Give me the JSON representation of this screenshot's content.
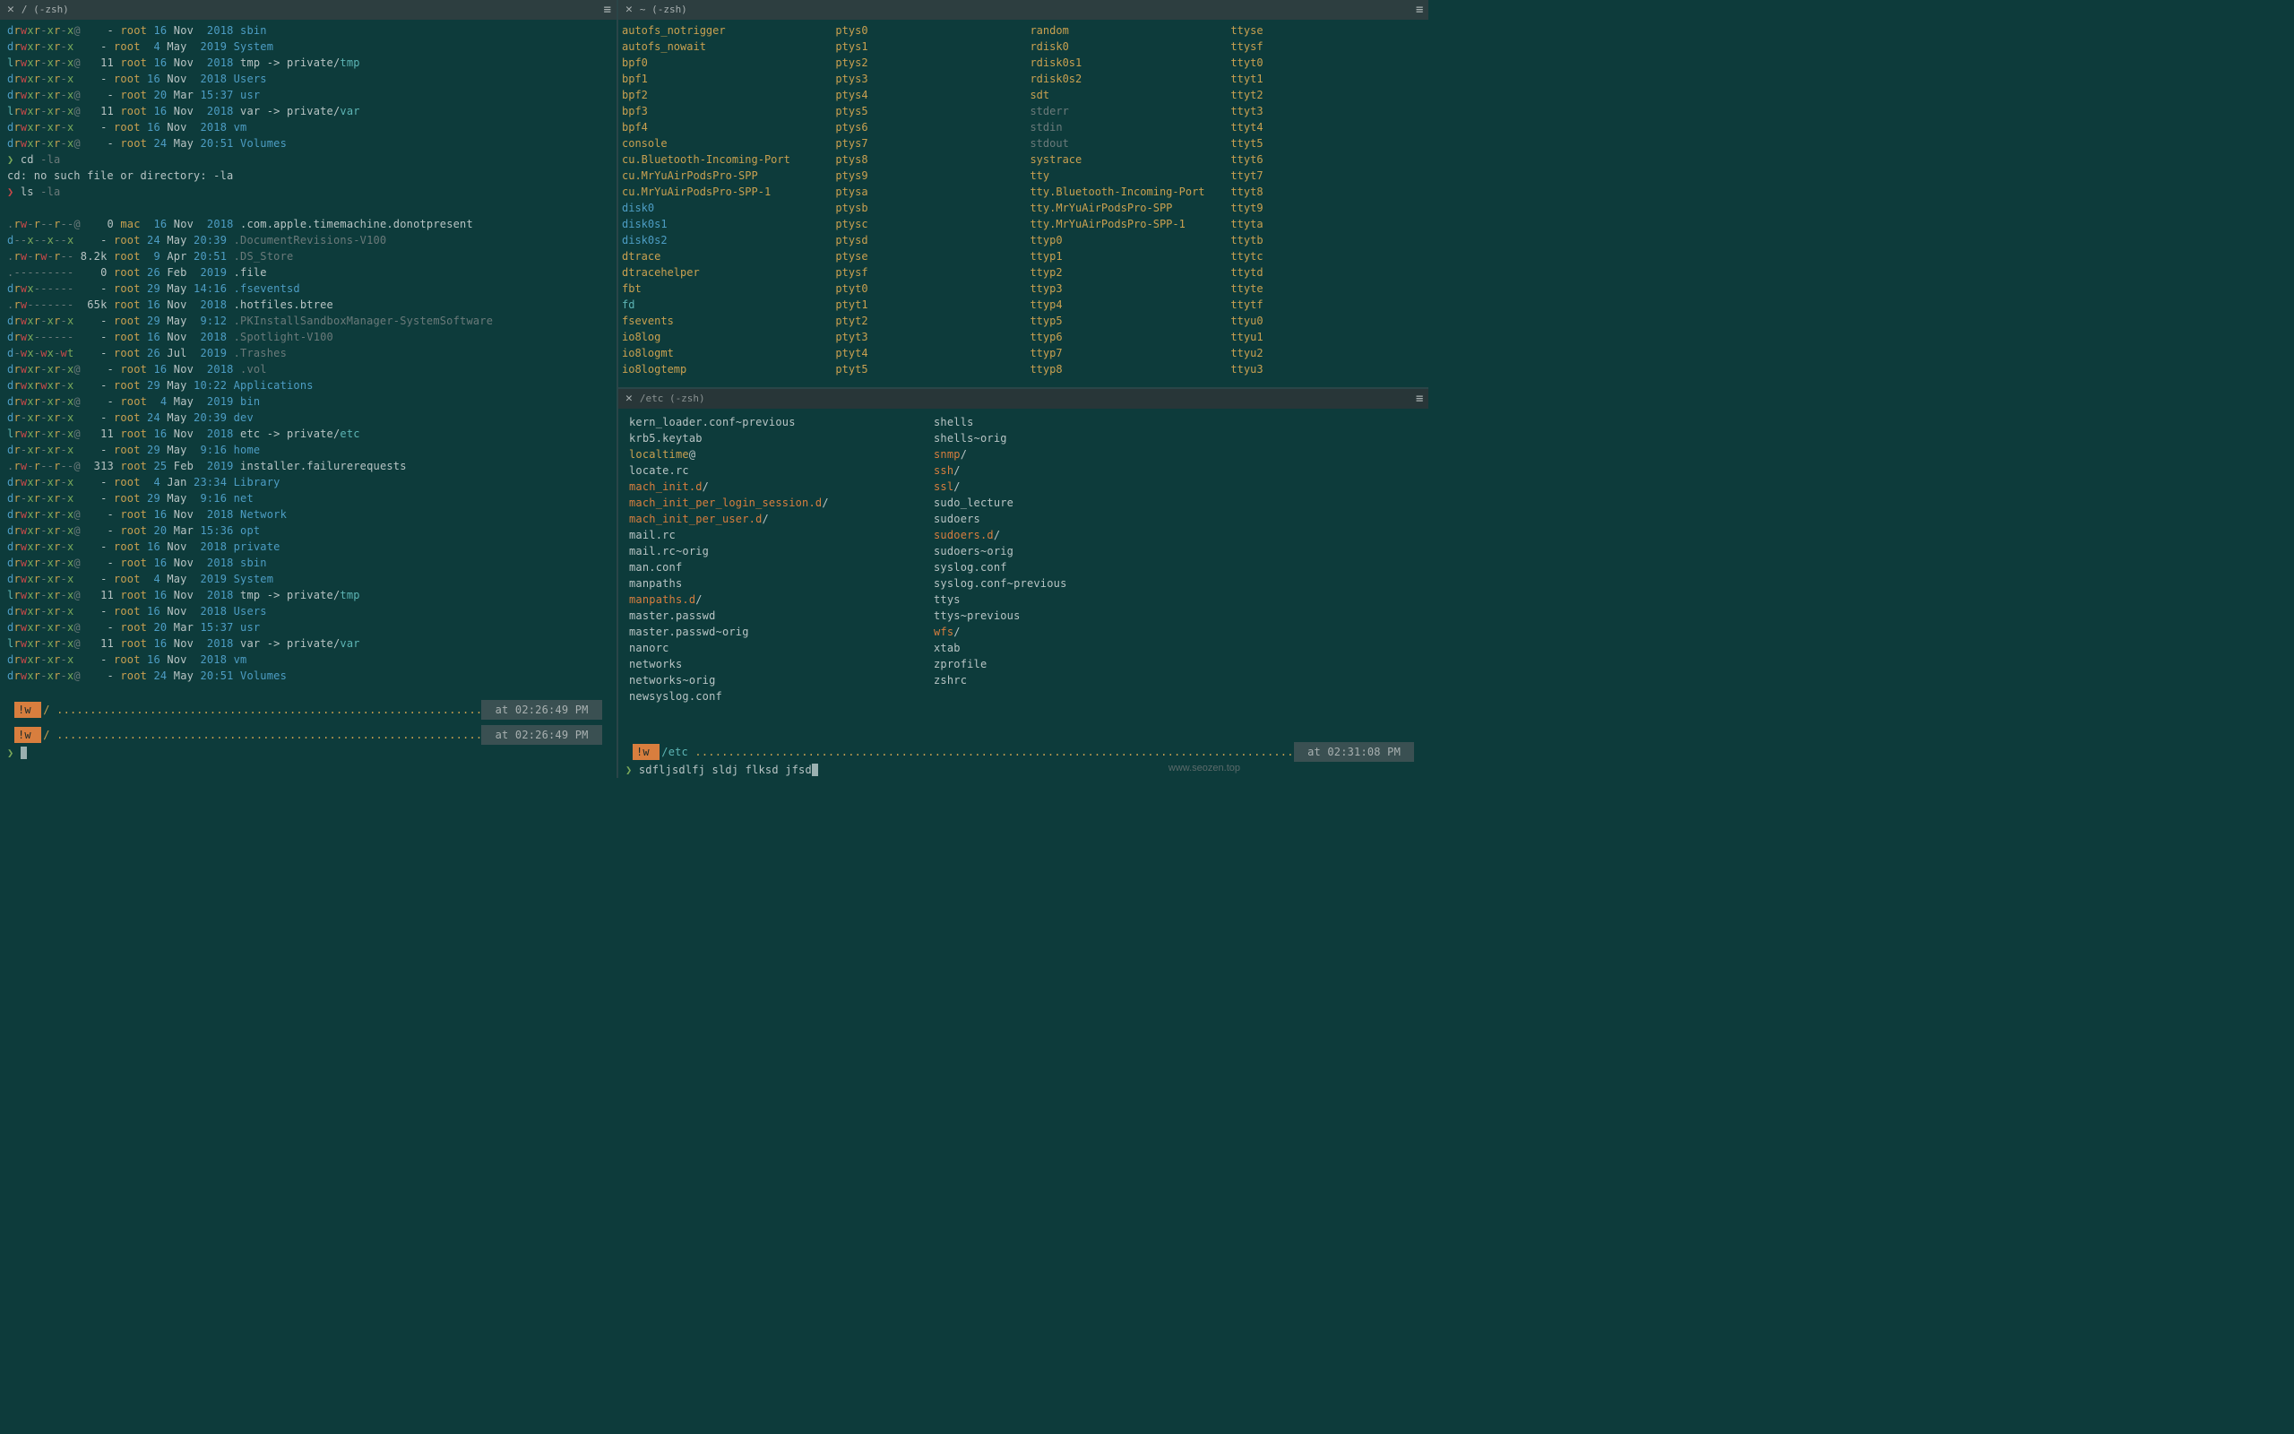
{
  "watermark": "www.seozen.top",
  "panes": {
    "left": {
      "tab_title": "/ (-zsh)",
      "status_path": "/",
      "status_time": "02:26:49 PM",
      "prompt": "❯"
    },
    "right_top": {
      "tab_title": "~ (-zsh)"
    },
    "right_bot": {
      "tab_title": "/etc (-zsh)",
      "status_path": "/etc",
      "status_time": "02:31:08 PM",
      "prompt": "❯",
      "typed": "sdfljsdlfj sldj flksd jfsd"
    }
  },
  "left_lines": [
    {
      "perm": "drwxr-xr-x@",
      "links": "-",
      "owner": "root",
      "d": "16",
      "mon": "Nov",
      "y": "2018",
      "name": "sbin",
      "cls": "c-blue"
    },
    {
      "perm": "drwxr-xr-x",
      "links": "-",
      "owner": "root",
      "d": "4",
      "mon": "May",
      "y": "2019",
      "name": "System",
      "cls": "c-blue"
    },
    {
      "perm": "lrwxr-xr-x@",
      "links": "11",
      "owner": "root",
      "d": "16",
      "mon": "Nov",
      "y": "2018",
      "name": "tmp -> private/",
      "tail": "tmp",
      "cls": "",
      "tcls": "c-cyan"
    },
    {
      "perm": "drwxr-xr-x",
      "links": "-",
      "owner": "root",
      "d": "16",
      "mon": "Nov",
      "y": "2018",
      "name": "Users",
      "cls": "c-blue"
    },
    {
      "perm": "drwxr-xr-x@",
      "links": "-",
      "owner": "root",
      "d": "20",
      "mon": "Mar",
      "y": "15:37",
      "name": "usr",
      "cls": "c-blue"
    },
    {
      "perm": "lrwxr-xr-x@",
      "links": "11",
      "owner": "root",
      "d": "16",
      "mon": "Nov",
      "y": "2018",
      "name": "var -> private/",
      "tail": "var",
      "cls": "",
      "tcls": "c-cyan"
    },
    {
      "perm": "drwxr-xr-x",
      "links": "-",
      "owner": "root",
      "d": "16",
      "mon": "Nov",
      "y": "2018",
      "name": "vm",
      "cls": "c-blue"
    },
    {
      "perm": "drwxr-xr-x@",
      "links": "-",
      "owner": "root",
      "d": "24",
      "mon": "May",
      "y": "20:51",
      "name": "Volumes",
      "cls": "c-blue"
    }
  ],
  "left_cmds": [
    {
      "prompt": "❯",
      "cmd": "cd -la",
      "err": "cd: no such file or directory: -la"
    },
    {
      "prompt": "❯",
      "cmd": "ls -la"
    }
  ],
  "left_ls2": [
    {
      "perm": ".rw-r--r--@",
      "links": "0",
      "owner": "mac",
      "d": "16",
      "mon": "Nov",
      "y": "2018",
      "name": ".com.apple.timemachine.donotpresent",
      "cls": ""
    },
    {
      "perm": "d--x--x--x",
      "links": "-",
      "owner": "root",
      "d": "24",
      "mon": "May",
      "y": "20:39",
      "name": ".DocumentRevisions-V100",
      "cls": "c-grey"
    },
    {
      "perm": ".rw-rw-r--",
      "links": "8.2k",
      "owner": "root",
      "d": "9",
      "mon": "Apr",
      "y": "20:51",
      "name": ".DS_Store",
      "cls": "c-grey"
    },
    {
      "perm": ".---------",
      "links": "0",
      "owner": "root",
      "d": "26",
      "mon": "Feb",
      "y": "2019",
      "name": ".file",
      "cls": ""
    },
    {
      "perm": "drwx------",
      "links": "-",
      "owner": "root",
      "d": "29",
      "mon": "May",
      "y": "14:16",
      "name": ".fseventsd",
      "cls": "c-blue"
    },
    {
      "perm": ".rw-------",
      "links": "65k",
      "owner": "root",
      "d": "16",
      "mon": "Nov",
      "y": "2018",
      "name": ".hotfiles.btree",
      "cls": ""
    },
    {
      "perm": "drwxr-xr-x",
      "links": "-",
      "owner": "root",
      "d": "29",
      "mon": "May",
      "y": "9:12",
      "name": ".PKInstallSandboxManager-SystemSoftware",
      "cls": "c-grey"
    },
    {
      "perm": "drwx------",
      "links": "-",
      "owner": "root",
      "d": "16",
      "mon": "Nov",
      "y": "2018",
      "name": ".Spotlight-V100",
      "cls": "c-grey"
    },
    {
      "perm": "d-wx-wx-wt",
      "links": "-",
      "owner": "root",
      "d": "26",
      "mon": "Jul",
      "y": "2019",
      "name": ".Trashes",
      "cls": "c-grey"
    },
    {
      "perm": "drwxr-xr-x@",
      "links": "-",
      "owner": "root",
      "d": "16",
      "mon": "Nov",
      "y": "2018",
      "name": ".vol",
      "cls": "c-grey"
    },
    {
      "perm": "drwxrwxr-x",
      "links": "-",
      "owner": "root",
      "d": "29",
      "mon": "May",
      "y": "10:22",
      "name": "Applications",
      "cls": "c-blue"
    },
    {
      "perm": "drwxr-xr-x@",
      "links": "-",
      "owner": "root",
      "d": "4",
      "mon": "May",
      "y": "2019",
      "name": "bin",
      "cls": "c-blue"
    },
    {
      "perm": "dr-xr-xr-x",
      "links": "-",
      "owner": "root",
      "d": "24",
      "mon": "May",
      "y": "20:39",
      "name": "dev",
      "cls": "c-blue"
    },
    {
      "perm": "lrwxr-xr-x@",
      "links": "11",
      "owner": "root",
      "d": "16",
      "mon": "Nov",
      "y": "2018",
      "name": "etc -> private/",
      "tail": "etc",
      "cls": "",
      "tcls": "c-cyan"
    },
    {
      "perm": "dr-xr-xr-x",
      "links": "-",
      "owner": "root",
      "d": "29",
      "mon": "May",
      "y": "9:16",
      "name": "home",
      "cls": "c-blue"
    },
    {
      "perm": ".rw-r--r--@",
      "links": "313",
      "owner": "root",
      "d": "25",
      "mon": "Feb",
      "y": "2019",
      "name": "installer.failurerequests",
      "cls": ""
    },
    {
      "perm": "drwxr-xr-x",
      "links": "-",
      "owner": "root",
      "d": "4",
      "mon": "Jan",
      "y": "23:34",
      "name": "Library",
      "cls": "c-blue"
    },
    {
      "perm": "dr-xr-xr-x",
      "links": "-",
      "owner": "root",
      "d": "29",
      "mon": "May",
      "y": "9:16",
      "name": "net",
      "cls": "c-blue"
    },
    {
      "perm": "drwxr-xr-x@",
      "links": "-",
      "owner": "root",
      "d": "16",
      "mon": "Nov",
      "y": "2018",
      "name": "Network",
      "cls": "c-blue"
    },
    {
      "perm": "drwxr-xr-x@",
      "links": "-",
      "owner": "root",
      "d": "20",
      "mon": "Mar",
      "y": "15:36",
      "name": "opt",
      "cls": "c-blue"
    },
    {
      "perm": "drwxr-xr-x",
      "links": "-",
      "owner": "root",
      "d": "16",
      "mon": "Nov",
      "y": "2018",
      "name": "private",
      "cls": "c-blue"
    },
    {
      "perm": "drwxr-xr-x@",
      "links": "-",
      "owner": "root",
      "d": "16",
      "mon": "Nov",
      "y": "2018",
      "name": "sbin",
      "cls": "c-blue"
    },
    {
      "perm": "drwxr-xr-x",
      "links": "-",
      "owner": "root",
      "d": "4",
      "mon": "May",
      "y": "2019",
      "name": "System",
      "cls": "c-blue"
    },
    {
      "perm": "lrwxr-xr-x@",
      "links": "11",
      "owner": "root",
      "d": "16",
      "mon": "Nov",
      "y": "2018",
      "name": "tmp -> private/",
      "tail": "tmp",
      "cls": "",
      "tcls": "c-cyan"
    },
    {
      "perm": "drwxr-xr-x",
      "links": "-",
      "owner": "root",
      "d": "16",
      "mon": "Nov",
      "y": "2018",
      "name": "Users",
      "cls": "c-blue"
    },
    {
      "perm": "drwxr-xr-x@",
      "links": "-",
      "owner": "root",
      "d": "20",
      "mon": "Mar",
      "y": "15:37",
      "name": "usr",
      "cls": "c-blue"
    },
    {
      "perm": "lrwxr-xr-x@",
      "links": "11",
      "owner": "root",
      "d": "16",
      "mon": "Nov",
      "y": "2018",
      "name": "var -> private/",
      "tail": "var",
      "cls": "",
      "tcls": "c-cyan"
    },
    {
      "perm": "drwxr-xr-x",
      "links": "-",
      "owner": "root",
      "d": "16",
      "mon": "Nov",
      "y": "2018",
      "name": "vm",
      "cls": "c-blue"
    },
    {
      "perm": "drwxr-xr-x@",
      "links": "-",
      "owner": "root",
      "d": "24",
      "mon": "May",
      "y": "20:51",
      "name": "Volumes",
      "cls": "c-blue"
    }
  ],
  "dev_cols": [
    [
      {
        "t": "autofs_notrigger",
        "c": "c-yellow"
      },
      {
        "t": "autofs_nowait",
        "c": "c-yellow"
      },
      {
        "t": "bpf0",
        "c": "c-yellow"
      },
      {
        "t": "bpf1",
        "c": "c-yellow"
      },
      {
        "t": "bpf2",
        "c": "c-yellow"
      },
      {
        "t": "bpf3",
        "c": "c-yellow"
      },
      {
        "t": "bpf4",
        "c": "c-yellow"
      },
      {
        "t": "console",
        "c": "c-yellow"
      },
      {
        "t": "cu.Bluetooth-Incoming-Port",
        "c": "c-yellow"
      },
      {
        "t": "cu.MrYuAirPodsPro-SPP",
        "c": "c-yellow"
      },
      {
        "t": "cu.MrYuAirPodsPro-SPP-1",
        "c": "c-yellow"
      },
      {
        "t": "disk0",
        "c": "c-blue"
      },
      {
        "t": "disk0s1",
        "c": "c-blue"
      },
      {
        "t": "disk0s2",
        "c": "c-blue"
      },
      {
        "t": "dtrace",
        "c": "c-yellow"
      },
      {
        "t": "dtracehelper",
        "c": "c-yellow"
      },
      {
        "t": "fbt",
        "c": "c-yellow"
      },
      {
        "t": "fd",
        "c": "c-cyan"
      },
      {
        "t": "fsevents",
        "c": "c-yellow"
      },
      {
        "t": "io8log",
        "c": "c-yellow"
      },
      {
        "t": "io8logmt",
        "c": "c-yellow"
      },
      {
        "t": "io8logtemp",
        "c": "c-yellow"
      }
    ],
    [
      {
        "t": "ptys0",
        "c": "c-yellow"
      },
      {
        "t": "ptys1",
        "c": "c-yellow"
      },
      {
        "t": "ptys2",
        "c": "c-yellow"
      },
      {
        "t": "ptys3",
        "c": "c-yellow"
      },
      {
        "t": "ptys4",
        "c": "c-yellow"
      },
      {
        "t": "ptys5",
        "c": "c-yellow"
      },
      {
        "t": "ptys6",
        "c": "c-yellow"
      },
      {
        "t": "ptys7",
        "c": "c-yellow"
      },
      {
        "t": "ptys8",
        "c": "c-yellow"
      },
      {
        "t": "ptys9",
        "c": "c-yellow"
      },
      {
        "t": "ptysa",
        "c": "c-yellow"
      },
      {
        "t": "ptysb",
        "c": "c-yellow"
      },
      {
        "t": "ptysc",
        "c": "c-yellow"
      },
      {
        "t": "ptysd",
        "c": "c-yellow"
      },
      {
        "t": "ptyse",
        "c": "c-yellow"
      },
      {
        "t": "ptysf",
        "c": "c-yellow"
      },
      {
        "t": "ptyt0",
        "c": "c-yellow"
      },
      {
        "t": "ptyt1",
        "c": "c-yellow"
      },
      {
        "t": "ptyt2",
        "c": "c-yellow"
      },
      {
        "t": "ptyt3",
        "c": "c-yellow"
      },
      {
        "t": "ptyt4",
        "c": "c-yellow"
      },
      {
        "t": "ptyt5",
        "c": "c-yellow"
      }
    ],
    [
      {
        "t": "random",
        "c": "c-yellow"
      },
      {
        "t": "rdisk0",
        "c": "c-yellow"
      },
      {
        "t": "rdisk0s1",
        "c": "c-yellow"
      },
      {
        "t": "rdisk0s2",
        "c": "c-yellow"
      },
      {
        "t": "sdt",
        "c": "c-yellow"
      },
      {
        "t": "stderr",
        "c": "c-grey"
      },
      {
        "t": "stdin",
        "c": "c-grey"
      },
      {
        "t": "stdout",
        "c": "c-grey"
      },
      {
        "t": "systrace",
        "c": "c-yellow"
      },
      {
        "t": "tty",
        "c": "c-yellow"
      },
      {
        "t": "tty.Bluetooth-Incoming-Port",
        "c": "c-yellow"
      },
      {
        "t": "tty.MrYuAirPodsPro-SPP",
        "c": "c-yellow"
      },
      {
        "t": "tty.MrYuAirPodsPro-SPP-1",
        "c": "c-yellow"
      },
      {
        "t": "ttyp0",
        "c": "c-yellow"
      },
      {
        "t": "ttyp1",
        "c": "c-yellow"
      },
      {
        "t": "ttyp2",
        "c": "c-yellow"
      },
      {
        "t": "ttyp3",
        "c": "c-yellow"
      },
      {
        "t": "ttyp4",
        "c": "c-yellow"
      },
      {
        "t": "ttyp5",
        "c": "c-yellow"
      },
      {
        "t": "ttyp6",
        "c": "c-yellow"
      },
      {
        "t": "ttyp7",
        "c": "c-yellow"
      },
      {
        "t": "ttyp8",
        "c": "c-yellow"
      }
    ],
    [
      {
        "t": "ttyse",
        "c": "c-yellow"
      },
      {
        "t": "ttysf",
        "c": "c-yellow"
      },
      {
        "t": "ttyt0",
        "c": "c-yellow"
      },
      {
        "t": "ttyt1",
        "c": "c-yellow"
      },
      {
        "t": "ttyt2",
        "c": "c-yellow"
      },
      {
        "t": "ttyt3",
        "c": "c-yellow"
      },
      {
        "t": "ttyt4",
        "c": "c-yellow"
      },
      {
        "t": "ttyt5",
        "c": "c-yellow"
      },
      {
        "t": "ttyt6",
        "c": "c-yellow"
      },
      {
        "t": "ttyt7",
        "c": "c-yellow"
      },
      {
        "t": "ttyt8",
        "c": "c-yellow"
      },
      {
        "t": "ttyt9",
        "c": "c-yellow"
      },
      {
        "t": "ttyta",
        "c": "c-yellow"
      },
      {
        "t": "ttytb",
        "c": "c-yellow"
      },
      {
        "t": "ttytc",
        "c": "c-yellow"
      },
      {
        "t": "ttytd",
        "c": "c-yellow"
      },
      {
        "t": "ttyte",
        "c": "c-yellow"
      },
      {
        "t": "ttytf",
        "c": "c-yellow"
      },
      {
        "t": "ttyu0",
        "c": "c-yellow"
      },
      {
        "t": "ttyu1",
        "c": "c-yellow"
      },
      {
        "t": "ttyu2",
        "c": "c-yellow"
      },
      {
        "t": "ttyu3",
        "c": "c-yellow"
      }
    ]
  ],
  "etc_cols": [
    [
      {
        "t": "kern_loader.conf\\~previous",
        "c": ""
      },
      {
        "t": "krb5.keytab",
        "c": ""
      },
      {
        "t": "localtime",
        "c": "c-yellow",
        "suf": "@"
      },
      {
        "t": "locate.rc",
        "c": ""
      },
      {
        "t": "mach_init.d",
        "c": "c-orange",
        "suf": "/"
      },
      {
        "t": "mach_init_per_login_session.d",
        "c": "c-orange",
        "suf": "/"
      },
      {
        "t": "mach_init_per_user.d",
        "c": "c-orange",
        "suf": "/"
      },
      {
        "t": "mail.rc",
        "c": ""
      },
      {
        "t": "mail.rc\\~orig",
        "c": ""
      },
      {
        "t": "man.conf",
        "c": ""
      },
      {
        "t": "manpaths",
        "c": ""
      },
      {
        "t": "manpaths.d",
        "c": "c-orange",
        "suf": "/"
      },
      {
        "t": "master.passwd",
        "c": ""
      },
      {
        "t": "master.passwd\\~orig",
        "c": ""
      },
      {
        "t": "nanorc",
        "c": ""
      },
      {
        "t": "networks",
        "c": ""
      },
      {
        "t": "networks\\~orig",
        "c": ""
      },
      {
        "t": "newsyslog.conf",
        "c": ""
      }
    ],
    [
      {
        "t": "shells",
        "c": ""
      },
      {
        "t": "shells\\~orig",
        "c": ""
      },
      {
        "t": "snmp",
        "c": "c-orange",
        "suf": "/"
      },
      {
        "t": "ssh",
        "c": "c-orange",
        "suf": "/"
      },
      {
        "t": "ssl",
        "c": "c-orange",
        "suf": "/"
      },
      {
        "t": "sudo_lecture",
        "c": ""
      },
      {
        "t": "sudoers",
        "c": ""
      },
      {
        "t": "sudoers.d",
        "c": "c-orange",
        "suf": "/"
      },
      {
        "t": "sudoers\\~orig",
        "c": ""
      },
      {
        "t": "syslog.conf",
        "c": ""
      },
      {
        "t": "syslog.conf\\~previous",
        "c": ""
      },
      {
        "t": "ttys",
        "c": ""
      },
      {
        "t": "ttys\\~previous",
        "c": ""
      },
      {
        "t": "wfs",
        "c": "c-orange",
        "suf": "/"
      },
      {
        "t": "xtab",
        "c": ""
      },
      {
        "t": "zprofile",
        "c": ""
      },
      {
        "t": "zshrc",
        "c": ""
      }
    ]
  ],
  "labels": {
    "status_prefix": "!w ",
    "at": "at "
  }
}
